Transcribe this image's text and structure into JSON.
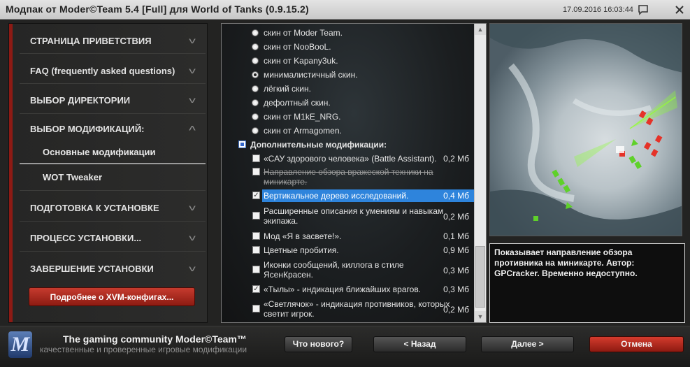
{
  "window": {
    "title": "Модпак от Moder©Team 5.4 [Full] для World of Tanks (0.9.15.2)",
    "datetime": "17.09.2016 16:03:44",
    "chat_icon": "speech-bubble-icon",
    "close_icon": "close-icon"
  },
  "sidebar": {
    "items": [
      {
        "label": "СТРАНИЦА ПРИВЕТСТВИЯ"
      },
      {
        "label": "FAQ (frequently asked questions)"
      },
      {
        "label": "ВЫБОР ДИРЕКТОРИИ"
      },
      {
        "label": "ВЫБОР МОДИФИКАЦИЙ:"
      },
      {
        "label": "Основные модификации"
      },
      {
        "label": "WOT Tweaker"
      },
      {
        "label": "ПОДГОТОВКА К УСТАНОВКЕ"
      },
      {
        "label": "ПРОЦЕСС УСТАНОВКИ..."
      },
      {
        "label": "ЗАВЕРШЕНИЕ УСТАНОВКИ"
      }
    ],
    "xvm_button": "Подробнее о XVM-конфигах...",
    "accent_color": "#8d1a14"
  },
  "list": {
    "radio_options": [
      {
        "label": "скин от Moder Team."
      },
      {
        "label": "скин от NooBooL."
      },
      {
        "label": "скин от Kapany3uk."
      },
      {
        "label": "минималистичный скин."
      },
      {
        "label": "лёгкий скин."
      },
      {
        "label": "дефолтный скин."
      },
      {
        "label": "скин от M1kE_NRG."
      },
      {
        "label": "скин от Armagomen."
      }
    ],
    "section_header": "Дополнительные модификации:",
    "items": [
      {
        "label": "«САУ здорового человека» (Battle Assistant).",
        "size": "0,2 Мб"
      },
      {
        "label_line1": "Направление обзора вражеской техники на",
        "label_line2": "миникарте."
      },
      {
        "label": "Вертикальное дерево исследований.",
        "size": "0,4 Мб"
      },
      {
        "label_line1": "Расширенные описания к умениям и навыкам",
        "label_line2": "экипажа.",
        "size": "0,2 Мб"
      },
      {
        "label": "Мод «Я в засвете!».",
        "size": "0,1 Мб"
      },
      {
        "label": "Цветные пробития.",
        "size": "0,9 Мб"
      },
      {
        "label_line1": "Иконки сообщений, киллога в стиле",
        "label_line2": "ЯсенКрасен.",
        "size": "0,3 Мб"
      },
      {
        "label": "«Тылы» - индикация ближайших врагов.",
        "size": "0,3 Мб"
      },
      {
        "label_line1": "«Светлячок» - индикация противников, которых",
        "label_line2": "светит игрок.",
        "size": "0,2 Мб"
      }
    ],
    "highlight_color": "#2e84dc"
  },
  "description": {
    "text": "Показывает направление обзора противника на миникарте. Автор: GPCracker. Временно недоступно."
  },
  "footer": {
    "logo_letter": "M",
    "brand": "The gaming community Moder©Team™",
    "brand_sub": "качественные и проверенные игровые модификации",
    "whats_new": "Что нового?",
    "back": "< Назад",
    "next": "Далее >",
    "cancel": "Отмена"
  }
}
